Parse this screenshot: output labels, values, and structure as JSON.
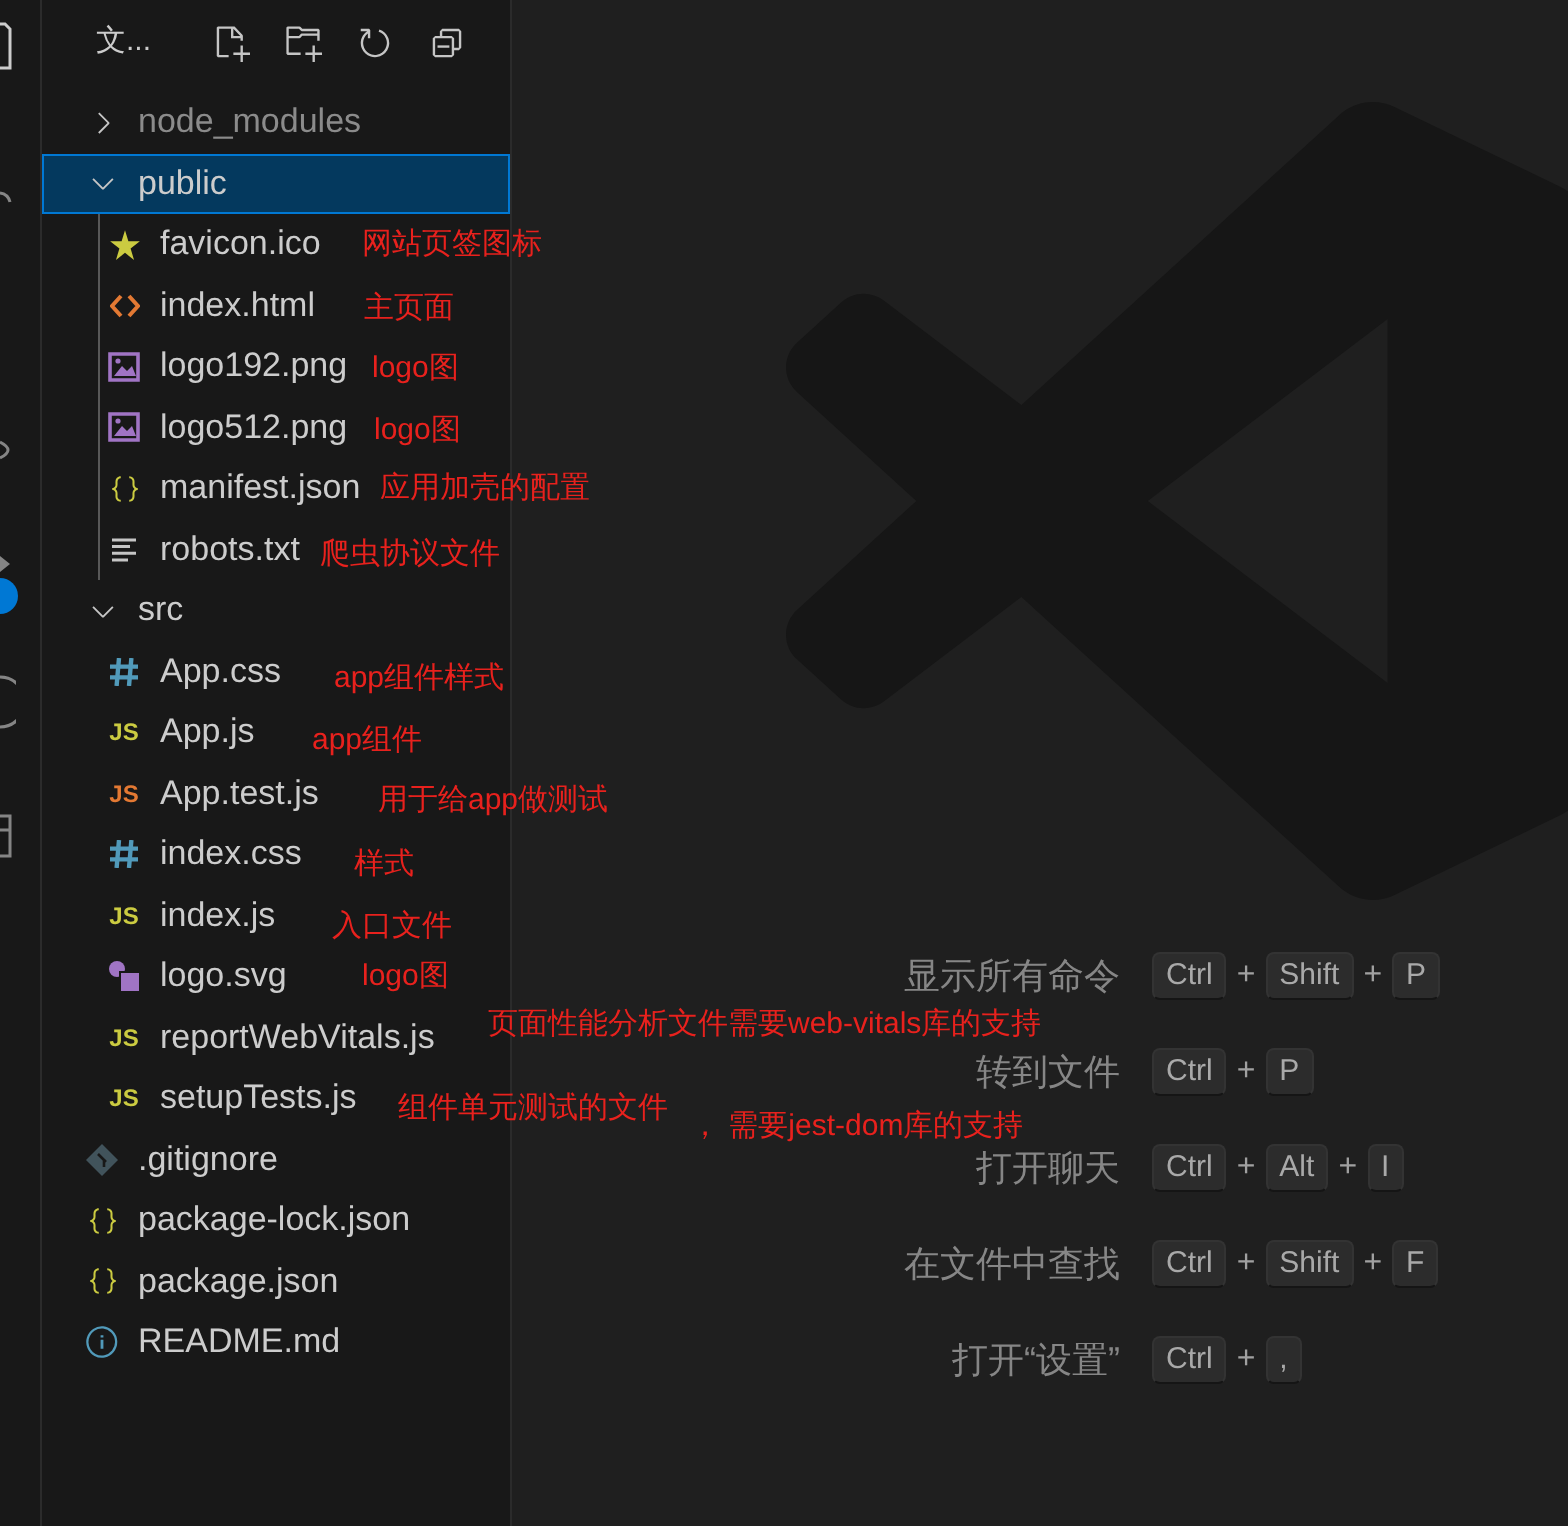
{
  "sidebar": {
    "title": "文...",
    "tree": [
      {
        "name": "node_modules",
        "kind": "folder",
        "expanded": false,
        "selected": false,
        "dimmed": true
      },
      {
        "name": "public",
        "kind": "folder",
        "expanded": true,
        "selected": true,
        "dimmed": false,
        "children": [
          {
            "name": "favicon.ico",
            "kind": "star",
            "selected": false,
            "dimmed": false,
            "notes": [
              "网站页签图标"
            ]
          },
          {
            "name": "index.html",
            "kind": "html",
            "selected": false,
            "dimmed": false,
            "notes": [
              "主页面"
            ]
          },
          {
            "name": "logo192.png",
            "kind": "image",
            "selected": false,
            "dimmed": false,
            "notes": [
              "logo图"
            ]
          },
          {
            "name": "logo512.png",
            "kind": "image",
            "selected": false,
            "dimmed": false,
            "notes": [
              "logo图"
            ]
          },
          {
            "name": "manifest.json",
            "kind": "json",
            "selected": false,
            "dimmed": false,
            "notes": [
              "应用加壳的配置"
            ]
          },
          {
            "name": "robots.txt",
            "kind": "text",
            "selected": false,
            "dimmed": false,
            "notes": [
              "爬虫协议文件"
            ]
          }
        ]
      },
      {
        "name": "src",
        "kind": "folder",
        "expanded": true,
        "selected": false,
        "dimmed": false,
        "children": [
          {
            "name": "App.css",
            "kind": "css",
            "selected": false,
            "dimmed": false,
            "notes": [
              "app组件样式"
            ]
          },
          {
            "name": "App.js",
            "kind": "js",
            "badge": "JS",
            "selected": false,
            "dimmed": false,
            "notes": [
              "app组件"
            ]
          },
          {
            "name": "App.test.js",
            "kind": "test",
            "badge": "JS",
            "selected": false,
            "dimmed": false,
            "notes": [
              "用于给app做测试"
            ]
          },
          {
            "name": "index.css",
            "kind": "css",
            "selected": false,
            "dimmed": false,
            "notes": [
              "样式"
            ]
          },
          {
            "name": "index.js",
            "kind": "js",
            "badge": "JS",
            "selected": false,
            "dimmed": false,
            "notes": [
              "入口文件"
            ]
          },
          {
            "name": "logo.svg",
            "kind": "svg",
            "selected": false,
            "dimmed": false,
            "notes": [
              "logo图"
            ]
          },
          {
            "name": "reportWebVitals.js",
            "kind": "js",
            "badge": "JS",
            "selected": false,
            "dimmed": false,
            "notes": [
              "页面性能分析文件需要web-vitals库的支持"
            ]
          },
          {
            "name": "setupTests.js",
            "kind": "js",
            "badge": "JS",
            "selected": false,
            "dimmed": false,
            "notes": [
              "组件单元测试的文件",
              "， 需要jest-dom库的支持"
            ]
          }
        ]
      },
      {
        "name": ".gitignore",
        "kind": "git",
        "selected": false,
        "dimmed": false
      },
      {
        "name": "package-lock.json",
        "kind": "json",
        "selected": false,
        "dimmed": false
      },
      {
        "name": "package.json",
        "kind": "json",
        "selected": false,
        "dimmed": false
      },
      {
        "name": "README.md",
        "kind": "info",
        "selected": false,
        "dimmed": false
      }
    ]
  },
  "editor": {
    "shortcuts": [
      {
        "label": "显示所有命令",
        "keys": [
          {
            "kind": "key",
            "text": "Ctrl"
          },
          {
            "kind": "plus",
            "text": "+"
          },
          {
            "kind": "key",
            "text": "Shift"
          },
          {
            "kind": "plus",
            "text": "+"
          },
          {
            "kind": "key",
            "text": "P"
          }
        ]
      },
      {
        "label": "转到文件",
        "keys": [
          {
            "kind": "key",
            "text": "Ctrl"
          },
          {
            "kind": "plus",
            "text": "+"
          },
          {
            "kind": "key",
            "text": "P"
          }
        ]
      },
      {
        "label": "打开聊天",
        "keys": [
          {
            "kind": "key",
            "text": "Ctrl"
          },
          {
            "kind": "plus",
            "text": "+"
          },
          {
            "kind": "key",
            "text": "Alt"
          },
          {
            "kind": "plus",
            "text": "+"
          },
          {
            "kind": "key",
            "text": "I"
          }
        ]
      },
      {
        "label": "在文件中查找",
        "keys": [
          {
            "kind": "key",
            "text": "Ctrl"
          },
          {
            "kind": "plus",
            "text": "+"
          },
          {
            "kind": "key",
            "text": "Shift"
          },
          {
            "kind": "plus",
            "text": "+"
          },
          {
            "kind": "key",
            "text": "F"
          }
        ]
      },
      {
        "label": "打开“设置”",
        "keys": [
          {
            "kind": "key",
            "text": "Ctrl"
          },
          {
            "kind": "plus",
            "text": "+"
          },
          {
            "kind": "key",
            "text": ","
          }
        ]
      }
    ]
  }
}
